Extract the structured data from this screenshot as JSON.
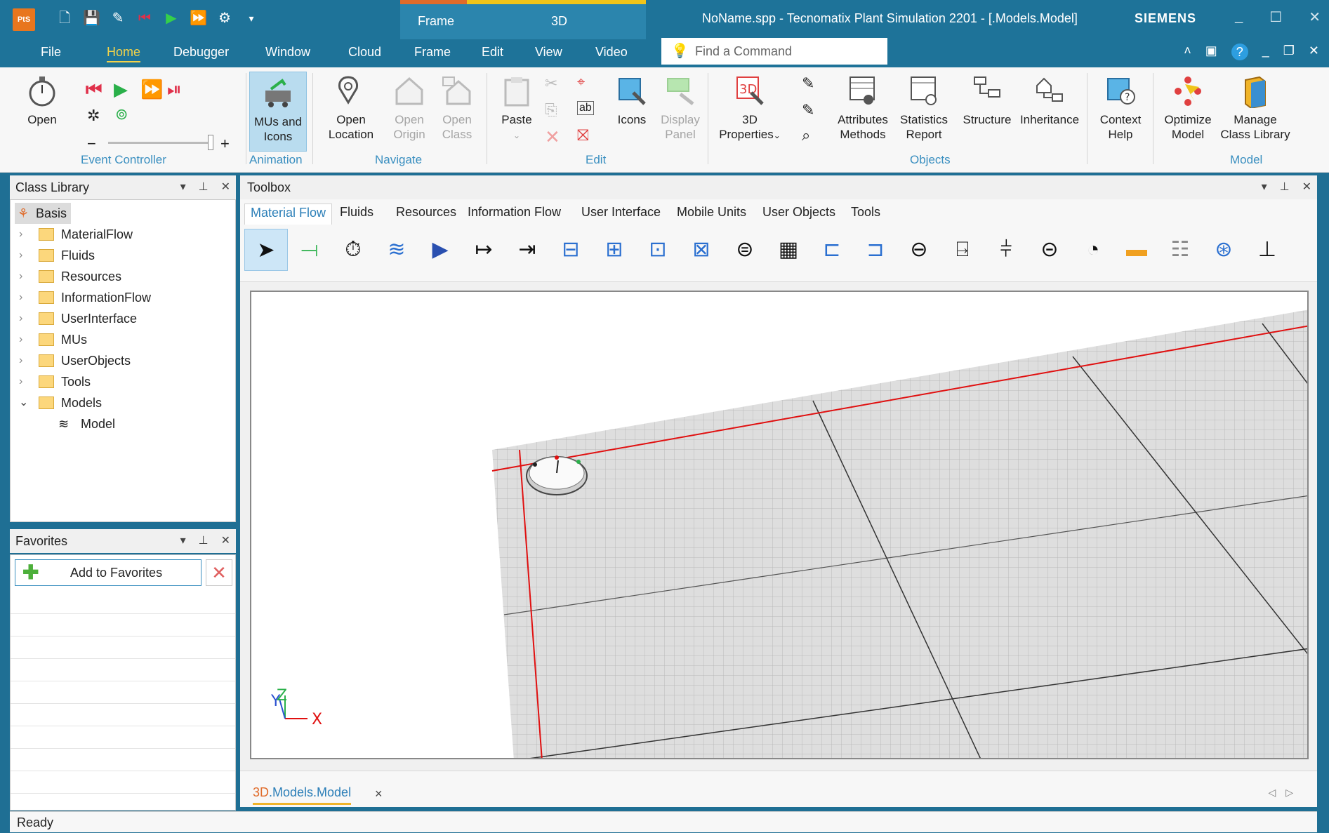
{
  "titlebar": {
    "app_logo": "PtS",
    "context_group_frame": "Frame",
    "context_group_3d": "3D",
    "window_title": "NoName.spp - Tecnomatix Plant Simulation 2201 - [.Models.Model]",
    "brand": "SIEMENS",
    "minimize": "_",
    "maximize": "☐",
    "close": "✕"
  },
  "menu": {
    "items": [
      "File",
      "Home",
      "Debugger",
      "Window",
      "Cloud",
      "Frame",
      "Edit",
      "View",
      "Video"
    ],
    "search_placeholder": "Find a Command"
  },
  "ribbon": {
    "open": "Open",
    "event_controller_label": "Event Controller",
    "mus_and_icons": [
      "MUs and",
      "Icons"
    ],
    "animation_label": "Animation",
    "open_location": [
      "Open",
      "Location"
    ],
    "open_origin": [
      "Open",
      "Origin"
    ],
    "open_class": [
      "Open",
      "Class"
    ],
    "navigate_label": "Navigate",
    "paste": "Paste",
    "icons": "Icons",
    "display_panel": [
      "Display",
      "Panel"
    ],
    "edit_label": "Edit",
    "properties_3d": [
      "3D",
      "Properties"
    ],
    "attributes_methods": [
      "Attributes",
      "Methods"
    ],
    "statistics_report": [
      "Statistics",
      "Report"
    ],
    "structure": "Structure",
    "inheritance": "Inheritance",
    "objects_label": "Objects",
    "context_help": [
      "Context",
      "Help"
    ],
    "optimize_model": [
      "Optimize",
      "Model"
    ],
    "manage_class_library": [
      "Manage",
      "Class Library"
    ],
    "model_label": "Model"
  },
  "class_library": {
    "title": "Class Library",
    "root": "Basis",
    "items": [
      "MaterialFlow",
      "Fluids",
      "Resources",
      "InformationFlow",
      "UserInterface",
      "MUs",
      "UserObjects",
      "Tools",
      "Models"
    ],
    "child": "Model"
  },
  "favorites": {
    "title": "Favorites",
    "add_button": "Add to Favorites"
  },
  "toolbox": {
    "title": "Toolbox",
    "tabs": [
      "Material Flow",
      "Fluids",
      "Resources",
      "Information Flow",
      "User Interface",
      "Mobile Units",
      "User Objects",
      "Tools"
    ]
  },
  "viewport": {
    "axis_x": "X",
    "axis_y": "Y",
    "axis_z": "Z"
  },
  "doc_tab": {
    "prefix": "3D",
    "name": ".Models.Model",
    "close": "×"
  },
  "status": "Ready",
  "colors": {
    "titlebar": "#1e7399",
    "accent": "#f3d34a",
    "group_label": "#3a8fc0"
  }
}
